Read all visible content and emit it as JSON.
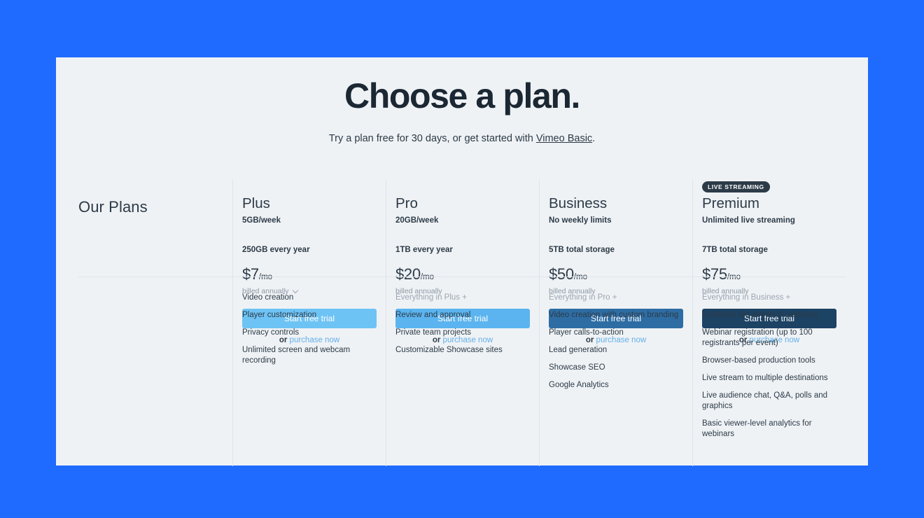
{
  "header": {
    "title": "Choose a plan.",
    "subtitle_prefix": "Try a plan free for 30 days, or get started with ",
    "subtitle_link": "Vimeo Basic",
    "subtitle_suffix": "."
  },
  "section_label": "Our Plans",
  "common": {
    "cta_label": "Start free trial",
    "or_label": "or",
    "purchase_label": "purchase now",
    "billing_label": "billed annually"
  },
  "colors": {
    "backdrop": "#1f6bff",
    "card": "#eff2f5",
    "text": "#2c3b47",
    "muted": "#9aa6b2",
    "link": "#62b0e8",
    "cta_plus": "#6ec3f5",
    "cta_pro": "#5bb4ef",
    "cta_business": "#2e6da4",
    "cta_premium": "#1c4264",
    "badge": "#2c3b47",
    "divider": "#dfe4e9"
  },
  "plans": [
    {
      "badge": "",
      "name": "Plus",
      "limit": "5GB/week",
      "storage": "250GB every year",
      "price": "$7",
      "period": "/mo",
      "billing": "billed annually",
      "has_billing_chevron": true,
      "cta_color": "#6ec3f5",
      "features_header": "",
      "features": [
        "Video creation",
        "Player customization",
        "Privacy controls",
        "Unlimited screen and webcam recording"
      ]
    },
    {
      "badge": "",
      "name": "Pro",
      "limit": "20GB/week",
      "storage": "1TB every year",
      "price": "$20",
      "period": "/mo",
      "billing": "billed annually",
      "has_billing_chevron": false,
      "cta_color": "#5bb4ef",
      "features_header": "Everything in Plus +",
      "features": [
        "Review and approval",
        "Private team projects",
        "Customizable Showcase sites"
      ]
    },
    {
      "badge": "",
      "name": "Business",
      "limit": "No weekly limits",
      "storage": "5TB total storage",
      "price": "$50",
      "period": "/mo",
      "billing": "billed annually",
      "has_billing_chevron": false,
      "cta_color": "#2e6da4",
      "features_header": "Everything in Pro +",
      "features": [
        "Video creation with custom branding",
        "Player calls-to-action",
        "Lead generation",
        "Showcase SEO",
        "Google Analytics"
      ]
    },
    {
      "badge": "LIVE STREAMING",
      "name": "Premium",
      "limit": "Unlimited live streaming",
      "storage": "7TB total storage",
      "price": "$75",
      "period": "/mo",
      "billing": "billed annually",
      "has_billing_chevron": false,
      "cta_color": "#1c4264",
      "features_header": "Everything in Business +",
      "features": [
        "Unlimited live events & webinars",
        "Webinar registration (up to 100 registrants per event)",
        "Browser-based production tools",
        "Live stream to multiple destinations",
        "Live audience chat, Q&A, polls and graphics",
        "Basic viewer-level analytics for webinars"
      ]
    }
  ]
}
